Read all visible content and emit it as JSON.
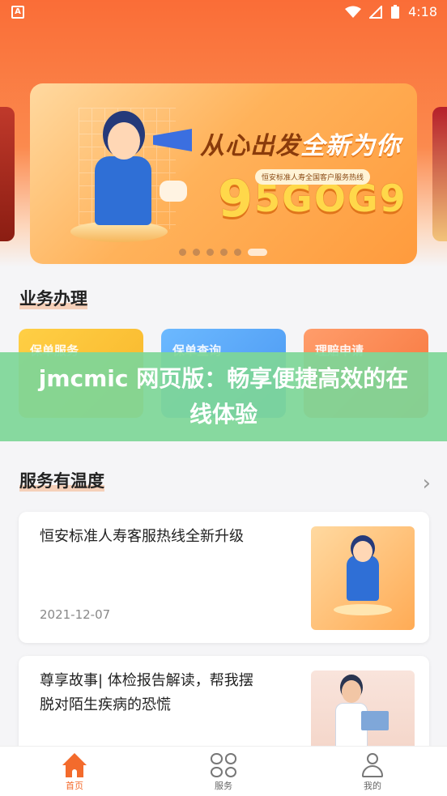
{
  "status_bar": {
    "time": "4:18",
    "app_icon": "A"
  },
  "banner": {
    "title_part1": "从心出发",
    "title_part2": "全新为你",
    "subtitle": "恒安标准人寿全国客户服务热线",
    "number_first": "9",
    "number_rest": "5GOG9",
    "dots": 6,
    "active_dot": 5
  },
  "business": {
    "title": "业务办理",
    "cards": [
      {
        "label": "保单服务"
      },
      {
        "label": "保单查询"
      },
      {
        "label": "理赔申请"
      }
    ]
  },
  "overlay": {
    "text": "jmcmic 网页版：畅享便捷高效的在线体验"
  },
  "warm_service": {
    "title": "服务有温度",
    "more_icon": "chevron-right-icon",
    "articles": [
      {
        "title": "恒安标准人寿客服热线全新升级",
        "date": "2021-12-07"
      },
      {
        "title": "尊享故事| 体检报告解读，帮我摆脱对陌生疾病的恐慌",
        "date": ""
      }
    ]
  },
  "bottom_nav": {
    "items": [
      {
        "label": "首页",
        "icon": "home-icon",
        "active": true
      },
      {
        "label": "服务",
        "icon": "service-icon",
        "active": false
      },
      {
        "label": "我的",
        "icon": "user-icon",
        "active": false
      }
    ]
  },
  "colors": {
    "brand_orange": "#f36b2c",
    "overlay_green": "#7ed698"
  }
}
